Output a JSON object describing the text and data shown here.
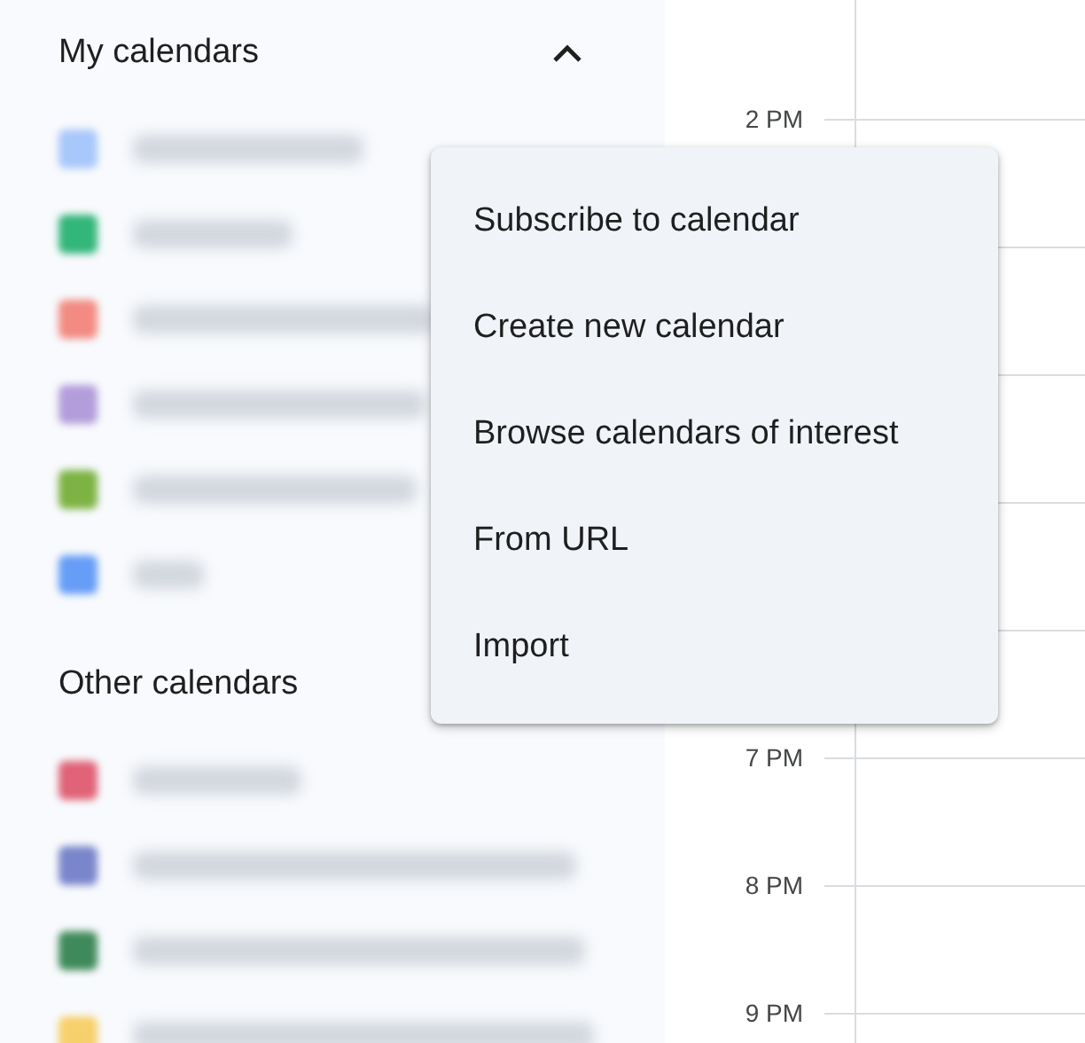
{
  "my_calendars": {
    "title": "My calendars",
    "expanded": true,
    "items": [
      {
        "color": "#a8c7fa"
      },
      {
        "color": "#33b679"
      },
      {
        "color": "#f28b82"
      },
      {
        "color": "#b39ddb"
      },
      {
        "color": "#7cb342"
      },
      {
        "color": "#669df6"
      }
    ]
  },
  "other_calendars": {
    "title": "Other calendars",
    "items": [
      {
        "color": "#e06377"
      },
      {
        "color": "#7986cb"
      },
      {
        "color": "#3f8a5a"
      },
      {
        "color": "#f6d06b"
      }
    ]
  },
  "time_grid": {
    "hours_above_menu": [
      {
        "label": "2 PM"
      }
    ],
    "hours_below_menu": [
      {
        "label": "7 PM"
      },
      {
        "label": "8 PM"
      },
      {
        "label": "9 PM"
      }
    ]
  },
  "add_menu": {
    "items": [
      {
        "label": "Subscribe to calendar"
      },
      {
        "label": "Create new calendar"
      },
      {
        "label": "Browse calendars of interest"
      },
      {
        "label": "From URL"
      },
      {
        "label": "Import"
      }
    ]
  }
}
